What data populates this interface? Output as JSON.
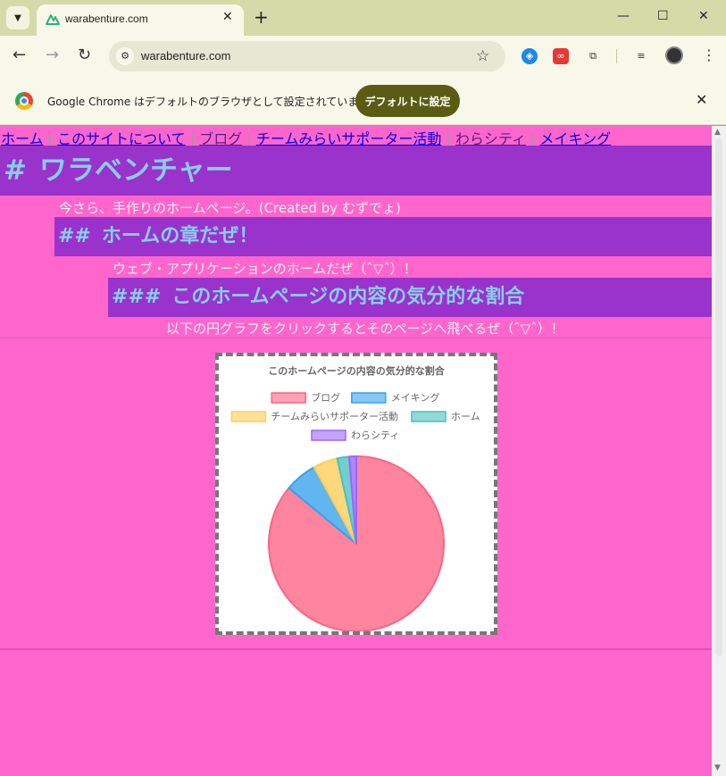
{
  "browser": {
    "tab_title": "warabenture.com",
    "tab_close": "✕",
    "new_tab": "+",
    "url": "warabenture.com",
    "window_minimize": "—",
    "window_maximize": "☐",
    "window_close": "✕"
  },
  "infobar": {
    "message": "Google Chrome はデフォルトのブラウザとして設定されていません",
    "button": "デフォルトに設定",
    "close": "✕"
  },
  "nav": {
    "items": [
      {
        "label": "ホーム",
        "visited": false
      },
      {
        "label": "このサイトについて",
        "visited": false
      },
      {
        "label": "ブログ",
        "visited": true
      },
      {
        "label": "チームみらいサポーター活動",
        "visited": false
      },
      {
        "label": "わらシティ",
        "visited": true
      },
      {
        "label": "メイキング",
        "visited": false
      }
    ],
    "separator": "|"
  },
  "page": {
    "h1_marker": "#",
    "h1": "ワラベンチャー",
    "p1": "今さら、手作りのホームページ。(Created by むずでょ)",
    "h2_marker": "##",
    "h2": "ホームの章だぜ！",
    "p2": "ウェブ・アプリケーションのホームだぜ（ˆ▽ˆ）！",
    "h3_marker": "###",
    "h3": "このホームページの内容の気分的な割合",
    "p3": "以下の円グラフをクリックするとそのページへ飛べるぜ（ˆ▽ˆ）！"
  },
  "chart_data": {
    "type": "pie",
    "title": "このホームページの内容の気分的な割合",
    "legend_position": "top",
    "slices": [
      {
        "label": "ブログ",
        "value": 86,
        "color": "#ff6384"
      },
      {
        "label": "メイキング",
        "value": 6,
        "color": "#36a2eb"
      },
      {
        "label": "チームみらいサポーター活動",
        "value": 4.5,
        "color": "#ffcd56"
      },
      {
        "label": "ホーム",
        "value": 2.2,
        "color": "#4bc0c0"
      },
      {
        "label": "わらシティ",
        "value": 1.3,
        "color": "#9966ff"
      }
    ]
  }
}
